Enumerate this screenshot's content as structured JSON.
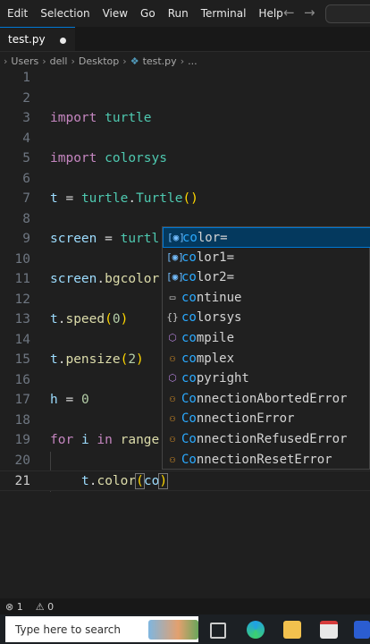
{
  "menu": [
    "Edit",
    "Selection",
    "View",
    "Go",
    "Run",
    "Terminal",
    "Help"
  ],
  "nav": {
    "back": "←",
    "forward": "→"
  },
  "tab": {
    "label": "test.py"
  },
  "breadcrumb": {
    "users": "Users",
    "dell": "dell",
    "desktop": "Desktop",
    "file": "test.py",
    "more": "..."
  },
  "editor": {
    "line_numbers": [
      "1",
      "2",
      "3",
      "4",
      "5",
      "6",
      "7",
      "8",
      "9",
      "10",
      "11",
      "12",
      "13",
      "14",
      "15",
      "16",
      "17",
      "18",
      "19",
      "20",
      "21"
    ],
    "code": {
      "l3": {
        "kw": "import",
        "mod": "turtle"
      },
      "l5": {
        "kw": "import",
        "mod": "colorsys"
      },
      "l7": {
        "var": "t",
        "eq": " = ",
        "mod": "turtle",
        "dot": ".",
        "cls": "Turtle",
        "parens": "()"
      },
      "l9": {
        "var": "screen",
        "eq": " = ",
        "mod": "turtl"
      },
      "l11": {
        "var": "screen",
        "dot": ".",
        "fn": "bgcolor"
      },
      "l13": {
        "var": "t",
        "dot": ".",
        "fn": "speed",
        "open": "(",
        "num": "0",
        "close": ")"
      },
      "l15": {
        "var": "t",
        "dot": ".",
        "fn": "pensize",
        "open": "(",
        "num": "2",
        "close": ")"
      },
      "l17": {
        "var": "h",
        "eq": " = ",
        "num": "0"
      },
      "l19": {
        "kw": "for",
        "var": "i",
        "kw2": "in",
        "fn": "range"
      },
      "l21": {
        "var": "t",
        "dot": ".",
        "fn": "color",
        "open": "(",
        "arg": "co",
        "close": ")"
      }
    }
  },
  "suggestions": [
    {
      "match": "co",
      "rest": "lor=",
      "icon": "[◉]",
      "kind": "field"
    },
    {
      "match": "co",
      "rest": "lor1=",
      "icon": "[◉]",
      "kind": "field"
    },
    {
      "match": "co",
      "rest": "lor2=",
      "icon": "[◉]",
      "kind": "field"
    },
    {
      "match": "co",
      "rest": "ntinue",
      "icon": "▭",
      "kind": "keyword"
    },
    {
      "match": "co",
      "rest": "lorsys",
      "icon": "{}",
      "kind": "module"
    },
    {
      "match": "co",
      "rest": "mpile",
      "icon": "⬡",
      "kind": "function"
    },
    {
      "match": "co",
      "rest": "mplex",
      "icon": "⚇",
      "kind": "class"
    },
    {
      "match": "co",
      "rest": "pyright",
      "icon": "⬡",
      "kind": "function"
    },
    {
      "match": "Co",
      "rest": "nnectionAbortedError",
      "icon": "⚇",
      "kind": "class"
    },
    {
      "match": "Co",
      "rest": "nnectionError",
      "icon": "⚇",
      "kind": "class"
    },
    {
      "match": "Co",
      "rest": "nnectionRefusedError",
      "icon": "⚇",
      "kind": "class"
    },
    {
      "match": "Co",
      "rest": "nnectionResetError",
      "icon": "⚇",
      "kind": "class"
    }
  ],
  "status": {
    "errors": "⊗ 1",
    "ports": "⚠ 0"
  },
  "taskbar": {
    "search_placeholder": "Type here to search"
  }
}
